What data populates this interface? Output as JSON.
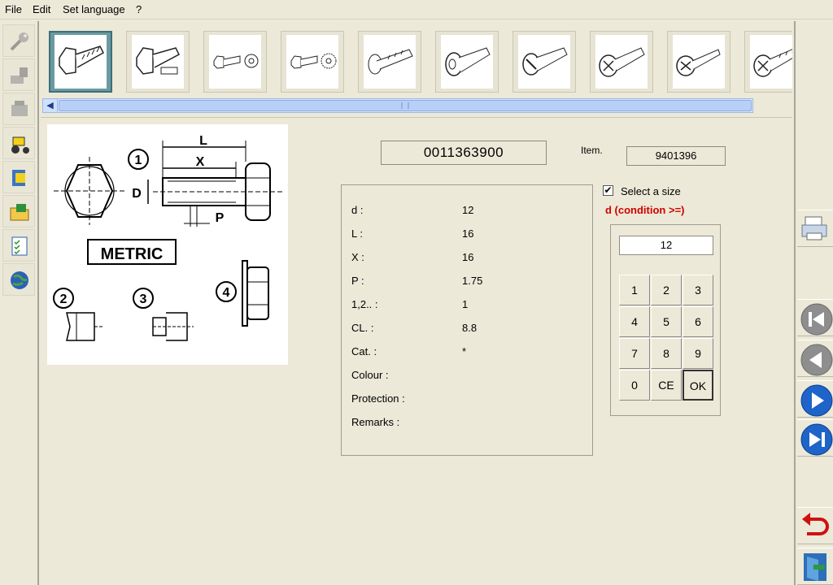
{
  "menu": {
    "file": "File",
    "edit": "Edit",
    "set_language": "Set language",
    "help": "?"
  },
  "left_toolbar": {
    "icons": [
      "wrench-icon",
      "hammer-icon",
      "engine-icon",
      "tractor-icon",
      "book-icon",
      "folder-icon",
      "checklist-icon",
      "globe-icon"
    ]
  },
  "thumbnail_strip": {
    "items": [
      "hex-bolt",
      "hex-bolt-with-label",
      "bolt-with-washer",
      "bolt-with-lock-washer",
      "flange-bolt",
      "socket-cap-screw",
      "slotted-screw",
      "phillips-screw",
      "countersunk-phillips-screw",
      "phillips-pan-screw"
    ],
    "selected_index": 0
  },
  "diagram": {
    "label_L": "L",
    "label_X": "X",
    "label_D": "D",
    "label_P": "P",
    "metric_label": "METRIC",
    "circle_1": "1",
    "circle_2": "2",
    "circle_3": "3",
    "circle_4": "4"
  },
  "part": {
    "code": "0011363900",
    "item_label": "Item.",
    "item_value": "9401396"
  },
  "specs": {
    "rows": [
      {
        "label": "d     :",
        "value": "12"
      },
      {
        "label": "L     :",
        "value": "16"
      },
      {
        "label": "X     :",
        "value": "16"
      },
      {
        "label": "P     :",
        "value": "1.75"
      },
      {
        "label": "1,2.. :",
        "value": "1"
      },
      {
        "label": "CL.   :",
        "value": "8.8"
      },
      {
        "label": "Cat. :",
        "value": "*"
      },
      {
        "label": "Colour :",
        "value": ""
      },
      {
        "label": "Protection :",
        "value": ""
      },
      {
        "label": "Remarks :",
        "value": ""
      }
    ]
  },
  "size_selector": {
    "checkbox_label": "Select a size",
    "checked_mark": "✔",
    "condition_text": "d  (condition >=)",
    "display_value": "12",
    "keys": [
      "1",
      "2",
      "3",
      "4",
      "5",
      "6",
      "7",
      "8",
      "9",
      "0",
      "CE",
      "OK"
    ]
  },
  "right_toolbar": {
    "icons": [
      "printer-icon",
      "first-icon",
      "previous-icon",
      "next-icon",
      "last-icon",
      "undo-icon",
      "exit-icon"
    ]
  },
  "colors": {
    "background": "#ece9d8",
    "selected_thumb": "#6a9aa1",
    "condition_red": "#d00000",
    "nav_blue": "#1f64c8",
    "nav_grey": "#8e8e8e"
  }
}
